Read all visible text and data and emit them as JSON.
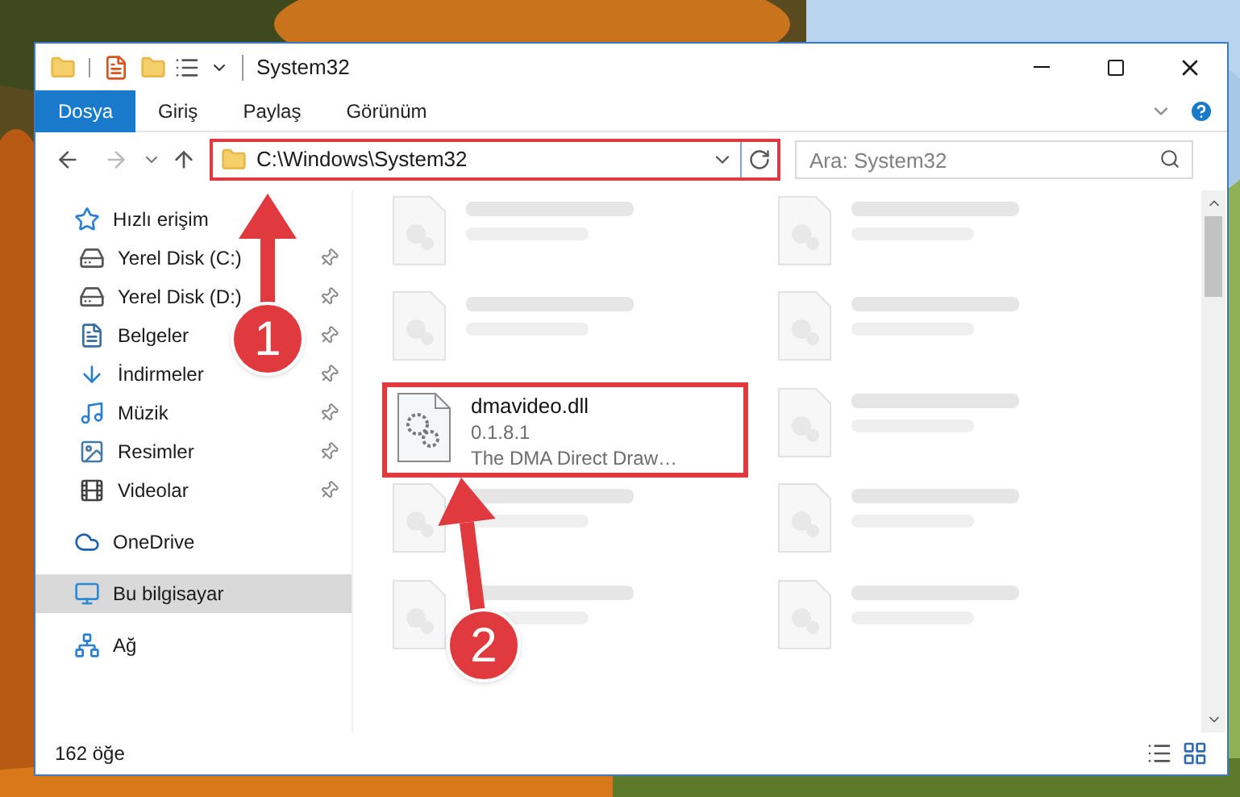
{
  "window": {
    "title": "System32"
  },
  "ribbon_tabs": [
    {
      "label": "Dosya",
      "selected": true
    },
    {
      "label": "Giriş",
      "selected": false
    },
    {
      "label": "Paylaş",
      "selected": false
    },
    {
      "label": "Görünüm",
      "selected": false
    }
  ],
  "address_bar": {
    "value": "C:\\Windows\\System32",
    "highlighted": true
  },
  "search": {
    "placeholder": "Ara: System32"
  },
  "sidebar": {
    "items": [
      {
        "label": "Hızlı erişim",
        "kind": "star",
        "selected": false,
        "children": [
          {
            "label": "Yerel Disk (C:)",
            "kind": "system-drive",
            "pinned": true,
            "selected": false
          },
          {
            "label": "Yerel Disk (D:)",
            "kind": "drive",
            "pinned": true,
            "selected": false
          },
          {
            "label": "Belgeler",
            "kind": "document",
            "pinned": true,
            "selected": false
          },
          {
            "label": "İndirmeler",
            "kind": "download",
            "pinned": true,
            "selected": false
          },
          {
            "label": "Müzik",
            "kind": "music",
            "pinned": true,
            "selected": false
          },
          {
            "label": "Resimler",
            "kind": "pictures",
            "pinned": true,
            "selected": false
          },
          {
            "label": "Videolar",
            "kind": "videos",
            "pinned": true,
            "selected": false
          }
        ]
      },
      {
        "label": "OneDrive",
        "kind": "cloud",
        "selected": false
      },
      {
        "label": "Bu bilgisayar",
        "kind": "computer",
        "selected": true
      },
      {
        "label": "Ağ",
        "kind": "network",
        "selected": false
      }
    ]
  },
  "files": [
    {
      "kind": "blurred"
    },
    {
      "kind": "blurred"
    },
    {
      "kind": "file",
      "name": "dmavideo.dll",
      "line_2": "0.1.8.1",
      "line_3": "The DMA Direct Draw…",
      "highlighted": true
    },
    {
      "kind": "blurred"
    },
    {
      "kind": "blurred"
    },
    {
      "kind": "blurred"
    },
    {
      "kind": "blurred"
    },
    {
      "kind": "blurred"
    },
    {
      "kind": "blurred"
    },
    {
      "kind": "blurred"
    }
  ],
  "status_bar": {
    "item_count": "162 öğe"
  },
  "annotations": [
    {
      "number": "1"
    },
    {
      "number": "2"
    }
  ]
}
